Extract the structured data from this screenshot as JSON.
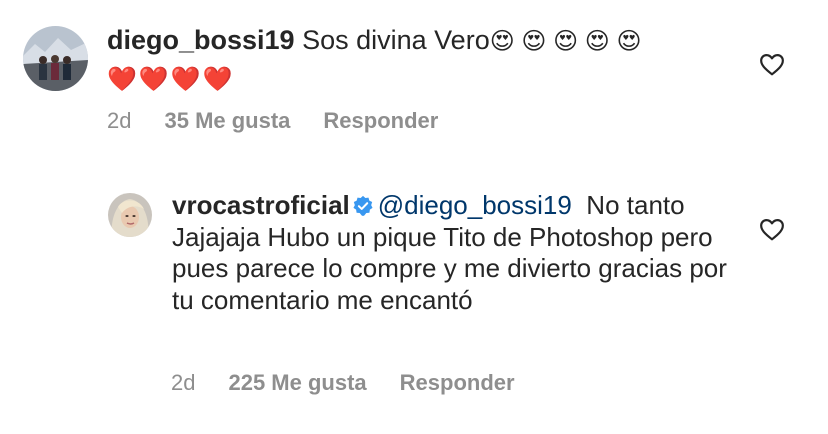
{
  "comments": [
    {
      "username": "diego_bossi19",
      "text": "Sos divina Vero",
      "emoji_line1": "😍 😍 😍 😍 😍",
      "emoji_line2": "❤️❤️❤️❤️",
      "time": "2d",
      "likes": "35 Me gusta",
      "reply": "Responder",
      "avatar_icon": "group-photo-avatar",
      "like_icon": "heart-outline-icon"
    },
    {
      "username": "vrocastroficial",
      "verified_icon": "verified-badge-icon",
      "mention": "@diego_bossi19",
      "text": "No tanto Jajajaja Hubo un pique Tito de Photoshop pero pues parece lo compre y me divierto gracias por tu comentario me encantó",
      "time": "2d",
      "likes": "225 Me gusta",
      "reply": "Responder",
      "avatar_icon": "profile-photo-avatar",
      "like_icon": "heart-outline-icon"
    }
  ],
  "colors": {
    "text": "#262626",
    "muted": "#8e8e8e",
    "mention": "#00376b",
    "verified": "#3897f0"
  }
}
